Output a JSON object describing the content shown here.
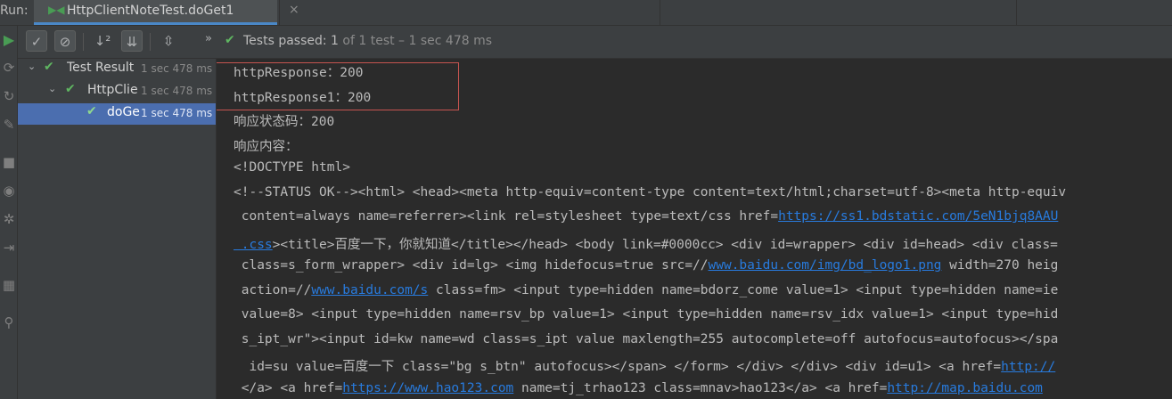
{
  "tabbar": {
    "run_label": "Run:",
    "tab_title": "HttpClientNoteTest.doGet1",
    "close_glyph": "×",
    "tab_icon": "▶◀"
  },
  "toolbar": {
    "show_passed_icon": "✓",
    "show_ignored_icon": "⊘",
    "sort_alpha_icon": "↓²",
    "sort_duration_icon": "⇊",
    "collapse_icon": "⇳",
    "expand_more": "»",
    "status_prefix": "Tests passed: ",
    "status_count": "1",
    "status_detail": " of 1 test – 1 sec 478 ms"
  },
  "tree": {
    "rows": [
      {
        "name": "Test Result",
        "duration": "1 sec 478 ms"
      },
      {
        "name": "HttpClie",
        "duration": "1 sec 478 ms"
      },
      {
        "name": "doGe",
        "duration": "1 sec 478 ms"
      }
    ]
  },
  "console": {
    "l1": "httpResponse：200",
    "l2": "httpResponse1：200",
    "l3": "响应状态码：200",
    "l4": "响应内容：",
    "l5": "<!DOCTYPE html>",
    "l6": "<!--STATUS OK--><html> <head><meta http-equiv=content-type content=text/html;charset=utf-8><meta http-equiv",
    "l7a": " content=always name=referrer><link rel=stylesheet type=text/css href=",
    "l7link": "https://ss1.bdstatic.com/5eN1bjq8AAU",
    "l8link": " .css",
    "l8b": "><title>百度一下，你就知道</title></head> <body link=#0000cc> <div id=wrapper> <div id=head> <div class=",
    "l9a": " class=s_form_wrapper> <div id=lg> <img hidefocus=true src=//",
    "l9link": "www.baidu.com/img/bd_logo1.png",
    "l9b": " width=270 heig",
    "l10a": " action=//",
    "l10link": "www.baidu.com/s",
    "l10b": " class=fm> <input type=hidden name=bdorz_come value=1> <input type=hidden name=ie",
    "l11": " value=8> <input type=hidden name=rsv_bp value=1> <input type=hidden name=rsv_idx value=1> <input type=hid",
    "l12": " s_ipt_wr\"><input id=kw name=wd class=s_ipt value maxlength=255 autocomplete=off autofocus=autofocus></spa",
    "l13a": "  id=su value=百度一下 class=\"bg s_btn\" autofocus></span> </form> </div> </div> <div id=u1> <a href=",
    "l13link": "http://",
    "l14a": " </a> <a href=",
    "l14link": "https://www.hao123.com",
    "l14b": " name=tj_trhao123 class=mnav>hao123</a> <a href=",
    "l14link2": "http://map.baidu.com"
  },
  "colors": {
    "background": "#2b2b2b",
    "panel": "#3c3f41",
    "pass_green": "#5fb661",
    "selection": "#4b6eaf",
    "link": "#287bde",
    "highlight_border": "#c75450"
  }
}
